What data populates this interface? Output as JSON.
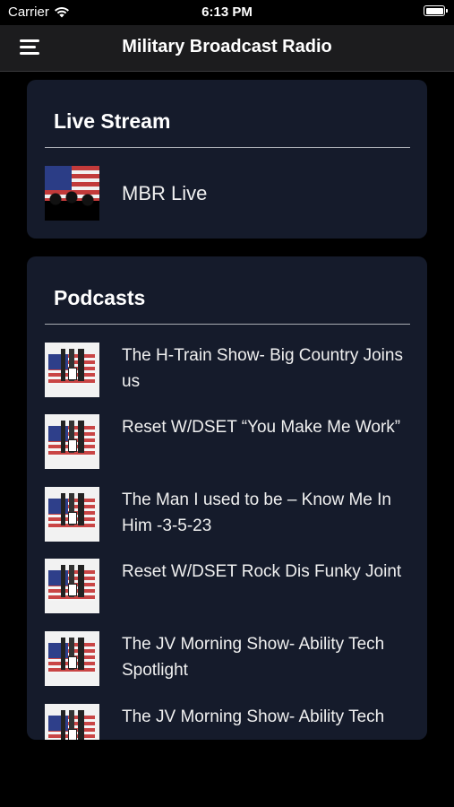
{
  "status": {
    "carrier": "Carrier",
    "time": "6:13 PM"
  },
  "nav": {
    "title": "Military Broadcast Radio"
  },
  "live": {
    "title": "Live Stream",
    "items": [
      {
        "label": "MBR Live"
      }
    ]
  },
  "podcasts": {
    "title": "Podcasts",
    "items": [
      {
        "label": "The H-Train Show- Big Country Joins us"
      },
      {
        "label": "Reset W/DSET “You Make Me Work”"
      },
      {
        "label": "The Man I used to be – Know Me In Him -3-5-23"
      },
      {
        "label": "Reset W/DSET Rock Dis Funky Joint"
      },
      {
        "label": "The JV Morning Show- Ability Tech Spotlight"
      },
      {
        "label": "The JV Morning Show- Ability Tech"
      }
    ]
  }
}
